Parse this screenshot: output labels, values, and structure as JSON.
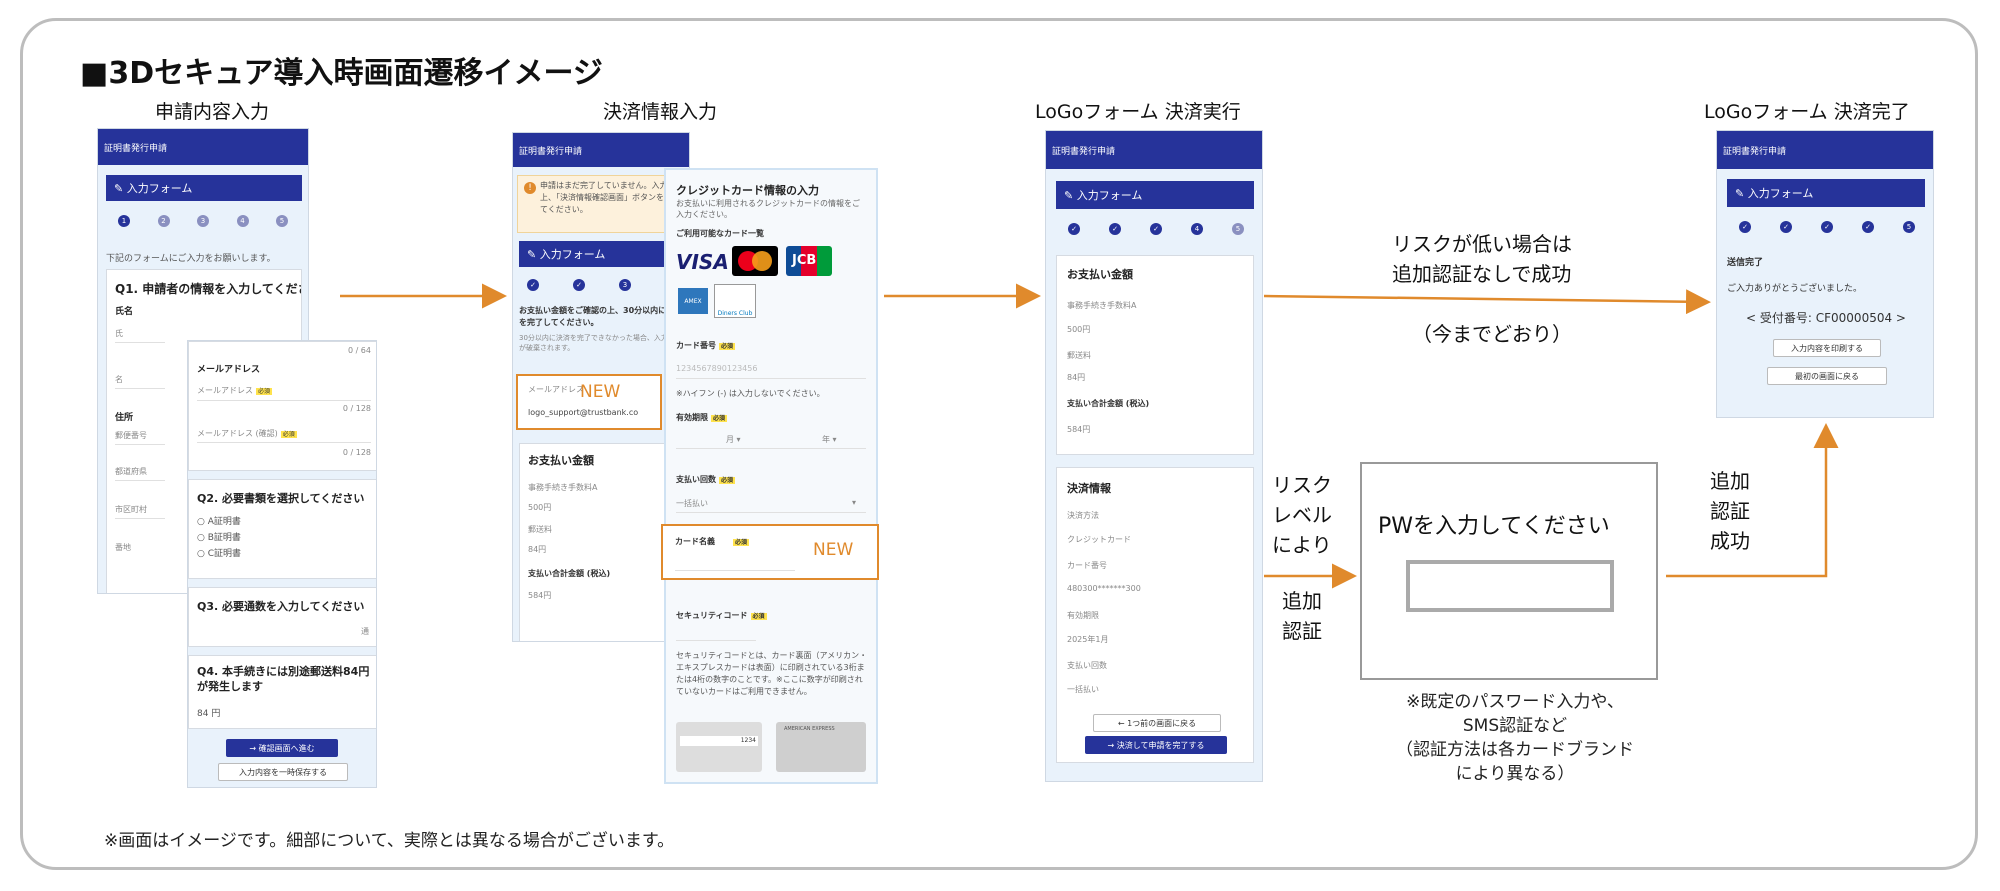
{
  "title": "■3Dセキュア導入時画面遷移イメージ",
  "columns": {
    "c1": "申請内容入力",
    "c2": "決済情報入力",
    "c3": "LoGoフォーム 決済実行",
    "c4": "LoGoフォーム 決済完了"
  },
  "s1": {
    "bar": "証明書発行申請",
    "form_title": "入力フォーム",
    "steps": [
      "1",
      "2",
      "3",
      "4",
      "5"
    ],
    "intro": "下記のフォームにご入力をお願いします。",
    "q1": "Q1. 申請者の情報を入力してください",
    "name_label": "氏名",
    "f_sei": "氏",
    "f_mei": "名",
    "addr_label": "住所",
    "f_zip": "郵便番号",
    "f_pref": "都道府県",
    "f_city": "市区町村",
    "f_street": "番地",
    "count1": "0 / 64",
    "email_label": "メールアドレス",
    "email_ph": "メールアドレス",
    "count2": "0 / 128",
    "email_confirm": "メールアドレス (確認)",
    "count3": "0 / 128",
    "required": "必須",
    "q2": "Q2. 必要書類を選択してください",
    "opt_a": "A証明書",
    "opt_b": "B証明書",
    "opt_c": "C証明書",
    "q3": "Q3. 必要通数を入力してください",
    "unit": "通",
    "q4": "Q4. 本手続きには別途郵送料84円が発生します",
    "q4_val": "84 円",
    "next_btn": "→ 確認画面へ進む",
    "save_btn": "入力内容を一時保存する"
  },
  "s2": {
    "bar": "証明書発行申請",
    "warn": "申請はまだ完了していません。入力の上、「決済情報確認画面」ボタンを押してください。",
    "form_title": "入力フォーム",
    "confirm_text": "お支払い金額をご確認の上、30分以内に決済を完了してください。",
    "confirm_sub": "30分以内に決済を完了できなかった場合、入力内容が破棄されます。",
    "email_label": "メールアドレス",
    "email_val": "logo_support@trustbank.co",
    "new": "NEW",
    "pay_title": "お支払い金額",
    "fee_label": "事務手続き手数料A",
    "fee_val": "500円",
    "post_label": "郵送料",
    "post_val": "84円",
    "total_label": "支払い合計金額 (税込)",
    "total_val": "584円"
  },
  "card": {
    "title": "クレジットカード情報の入力",
    "desc": "お支払いに利用されるクレジットカードの情報をご入力ください。",
    "brands_label": "ご利用可能なカード一覧",
    "brand_visa": "VISA",
    "brand_jcb": "JCB",
    "brand_amex": "AMEX",
    "brand_diners": "Diners Club",
    "num_label": "カード番号",
    "num_ph": "1234567890123456",
    "hyphen_note": "※ハイフン (-) は入力しないでください。",
    "exp_label": "有効期限",
    "exp_month": "月",
    "exp_year": "年",
    "times_label": "支払い回数",
    "times_val": "一括払い",
    "holder_label": "カード名義",
    "new": "NEW",
    "cvc_label": "セキュリティコード",
    "cvc_note": "セキュリティコードとは、カード裏面（アメリカン・エキスプレスカードは表面）に印刷されている3桁または4桁の数字のことです。※ここに数字が印刷されていないカードはご利用できません。",
    "sample1": "1234",
    "sample2": "AMERICAN EXPRESS",
    "required": "必須"
  },
  "s3": {
    "bar": "証明書発行申請",
    "form_title": "入力フォーム",
    "steps": [
      "✓",
      "✓",
      "✓",
      "4",
      "5"
    ],
    "pay_title": "お支払い金額",
    "fee_label": "事務手続き手数料A",
    "fee_val": "500円",
    "post_label": "郵送料",
    "post_val": "84円",
    "total_label": "支払い合計金額 (税込)",
    "total_val": "584円",
    "info_title": "決済情報",
    "method_label": "決済方法",
    "method_val": "クレジットカード",
    "num_label": "カード番号",
    "num_val": "480300*******300",
    "exp_label": "有効期限",
    "exp_val": "2025年1月",
    "times_label": "支払い回数",
    "times_val": "一括払い",
    "back_btn": "← 1つ前の画面に戻る",
    "submit_btn": "→ 決済して申請を完了する"
  },
  "s4": {
    "bar": "証明書発行申請",
    "form_title": "入力フォーム",
    "steps": [
      "✓",
      "✓",
      "✓",
      "✓",
      "5"
    ],
    "done": "送信完了",
    "thanks": "ご入力ありがとうございました。",
    "receipt": "< 受付番号: CF00000504 >",
    "print_btn": "入力内容を印刷する",
    "back_btn": "最初の画面に戻る"
  },
  "flow": {
    "low_risk_1": "リスクが低い場合は",
    "low_risk_2": "追加認証なしで成功",
    "as_before": "（今までどおり）",
    "risk_1": "リスク",
    "risk_2": "レベル",
    "risk_3": "により",
    "add_auth_1": "追加",
    "add_auth_2": "認証",
    "pw_prompt": "PWを入力してください",
    "note_1": "※既定のパスワード入力や、",
    "note_2": "SMS認証など",
    "note_3": "（認証方法は各カードブランド",
    "note_4": "により異なる）",
    "success_1": "追加",
    "success_2": "認証",
    "success_3": "成功"
  },
  "footnote": "※画面はイメージです。細部について、実際とは異なる場合がございます。",
  "colors": {
    "brand": "#26339a",
    "accent": "#e08a2c"
  }
}
